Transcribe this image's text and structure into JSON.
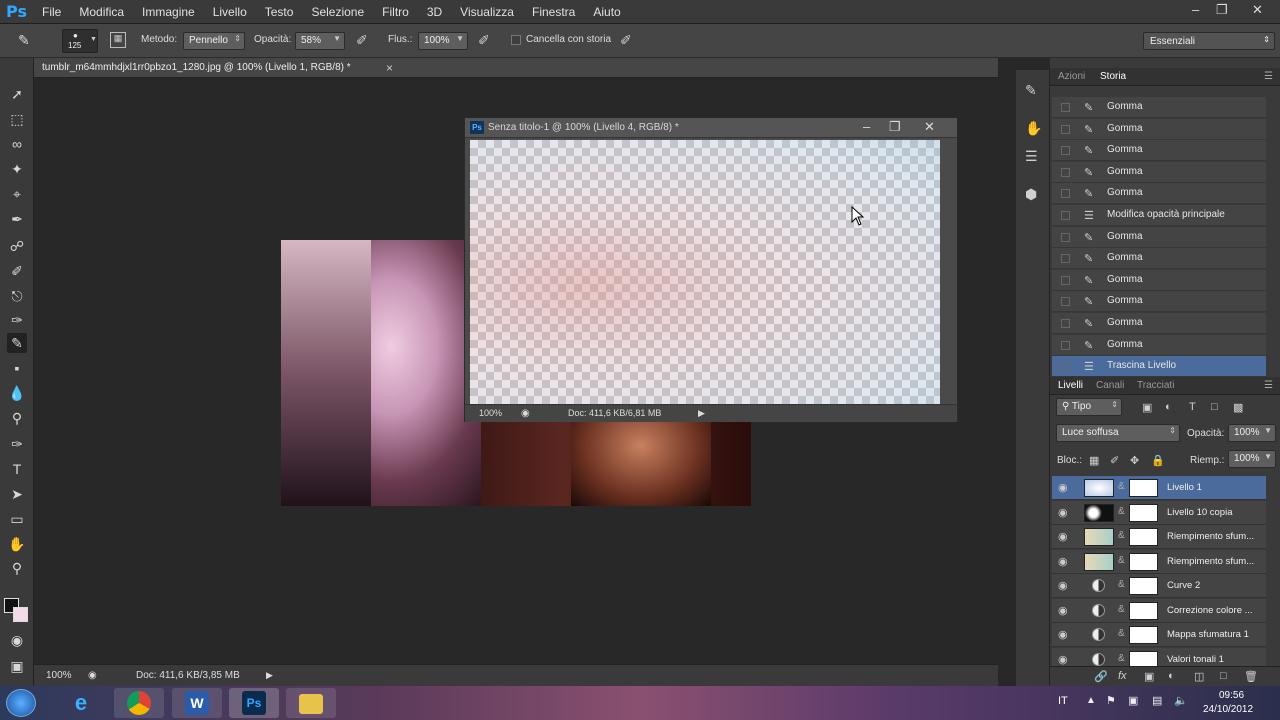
{
  "app": {
    "logo": "Ps"
  },
  "menu": [
    "File",
    "Modifica",
    "Immagine",
    "Livello",
    "Testo",
    "Selezione",
    "Filtro",
    "3D",
    "Visualizza",
    "Finestra",
    "Aiuto"
  ],
  "window_controls": {
    "minimize": "–",
    "restore": "❐",
    "close": "✕"
  },
  "options": {
    "brush_size": "125",
    "method_label": "Metodo:",
    "method_value": "Pennello",
    "opacity_label": "Opacità:",
    "opacity_value": "58%",
    "flow_label": "Flus.:",
    "flow_value": "100%",
    "erase_history_label": "Cancella con storia",
    "workspace": "Essenziali"
  },
  "document": {
    "tab_title": "tumblr_m64mmhdjxl1rr0pbzo1_1280.jpg @ 100% (Livello 1, RGB/8) *",
    "close": "×",
    "zoom": "100%",
    "doc_info": "Doc: 411,6 KB/3,85 MB"
  },
  "float_window": {
    "title": "Senza titolo-1 @ 100% (Livello 4, RGB/8) *",
    "zoom": "100%",
    "doc_info": "Doc: 411,6 KB/6,81 MB"
  },
  "history": {
    "tabs": [
      "Azioni",
      "Storia"
    ],
    "items": [
      {
        "label": "Gomma",
        "type": "eraser"
      },
      {
        "label": "Gomma",
        "type": "eraser"
      },
      {
        "label": "Gomma",
        "type": "eraser"
      },
      {
        "label": "Gomma",
        "type": "eraser"
      },
      {
        "label": "Gomma",
        "type": "eraser"
      },
      {
        "label": "Modifica opacità principale",
        "type": "doc"
      },
      {
        "label": "Gomma",
        "type": "eraser"
      },
      {
        "label": "Gomma",
        "type": "eraser"
      },
      {
        "label": "Gomma",
        "type": "eraser"
      },
      {
        "label": "Gomma",
        "type": "eraser"
      },
      {
        "label": "Gomma",
        "type": "eraser"
      },
      {
        "label": "Gomma",
        "type": "eraser"
      },
      {
        "label": "Trascina Livello",
        "type": "doc",
        "selected": true
      }
    ]
  },
  "layers": {
    "tabs": [
      "Livelli",
      "Canali",
      "Tracciati"
    ],
    "filter": "Tipo",
    "blend_mode": "Luce soffusa",
    "opacity_label": "Opacità:",
    "opacity_value": "100%",
    "lock_label": "Bloc.:",
    "fill_label": "Riemp.:",
    "fill_value": "100%",
    "items": [
      {
        "name": "Livello 1",
        "kind": "pixel",
        "selected": true
      },
      {
        "name": "Livello 10 copia",
        "kind": "pixel"
      },
      {
        "name": "Riempimento sfum...",
        "kind": "gradient"
      },
      {
        "name": "Riempimento sfum...",
        "kind": "gradient"
      },
      {
        "name": "Curve 2",
        "kind": "adjustment"
      },
      {
        "name": "Correzione colore ...",
        "kind": "adjustment"
      },
      {
        "name": "Mappa sfumatura 1",
        "kind": "adjustment"
      },
      {
        "name": "Valori tonali 1",
        "kind": "adjustment"
      }
    ]
  },
  "taskbar": {
    "lang": "IT",
    "time": "09:56",
    "date": "24/10/2012",
    "apps": [
      "windows-start",
      "internet-explorer",
      "chrome",
      "word",
      "photoshop",
      "explorer"
    ]
  },
  "colors": {
    "accent": "#4b6b9c",
    "ps_blue": "#31a8ff"
  }
}
